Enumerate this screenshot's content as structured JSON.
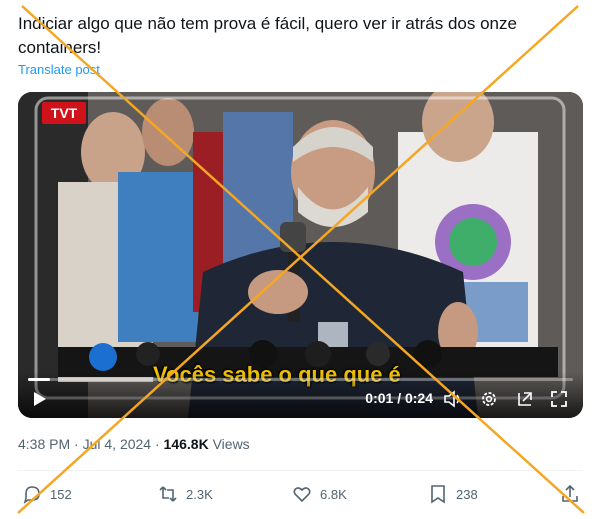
{
  "tweet": {
    "text": "Indiciar algo que não tem prova é fácil, quero ver ir atrás dos onze containers!",
    "translate_label": "Translate post"
  },
  "video": {
    "channel_logo_text": "TVT",
    "subtitle": "Vocês sabe o que que é",
    "time_display": "0:01 / 0:24",
    "progress_fraction": 0.04,
    "icons": [
      "play-icon",
      "volume-icon",
      "settings-icon",
      "popout-icon",
      "fullscreen-icon"
    ]
  },
  "meta": {
    "time": "4:38 PM",
    "separator": "·",
    "date": "Jul 4, 2024",
    "views_count": "146.8K",
    "views_label": "Views"
  },
  "actions": {
    "replies": "152",
    "reposts": "2.3K",
    "likes": "6.8K",
    "bookmarks": "238"
  },
  "colors": {
    "link": "#1d9bf0",
    "muted": "#536471",
    "overlay_cross": "#f5a623",
    "subtitle": "#f2c200"
  }
}
